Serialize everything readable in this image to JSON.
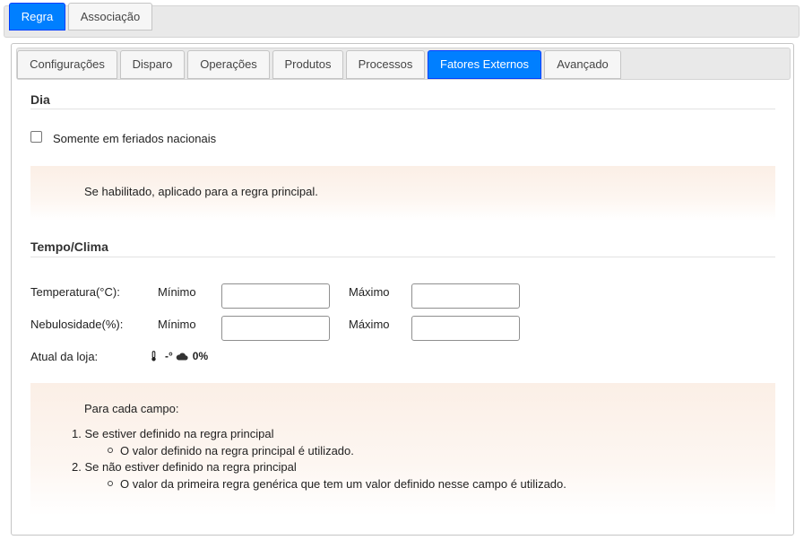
{
  "outer_tabs": [
    {
      "label": "Regra",
      "active": true
    },
    {
      "label": "Associação",
      "active": false
    }
  ],
  "inner_tabs": [
    {
      "label": "Configurações"
    },
    {
      "label": "Disparo"
    },
    {
      "label": "Operações"
    },
    {
      "label": "Produtos"
    },
    {
      "label": "Processos"
    },
    {
      "label": "Fatores Externos",
      "active": true
    },
    {
      "label": "Avançado"
    }
  ],
  "dia": {
    "title": "Dia",
    "holiday_checkbox_label": "Somente em feriados nacionais",
    "holiday_checked": false,
    "note": "Se habilitado, aplicado para a regra principal."
  },
  "tempo": {
    "title": "Tempo/Clima",
    "temperature_label": "Temperatura(°C):",
    "cloud_label": "Nebulosidade(%):",
    "min_label": "Mínimo",
    "max_label": "Máximo",
    "temperature_min": "",
    "temperature_max": "",
    "cloud_min": "",
    "cloud_max": "",
    "current_label": "Atual da loja:",
    "current_temperature": "-°",
    "current_cloud": "0%",
    "icons": [
      "thermometer-icon",
      "cloud-icon"
    ]
  },
  "help": {
    "intro": "Para cada campo:",
    "item1": "1. Se estiver definido na regra principal",
    "item1_sub": "O valor definido na regra principal é utilizado.",
    "item2": "2. Se não estiver definido na regra principal",
    "item2_sub": "O valor da primeira regra genérica que tem um valor definido nesse campo é utilizado."
  },
  "colors": {
    "active_tab": "#007fff",
    "note_background": "#fbefe6"
  }
}
